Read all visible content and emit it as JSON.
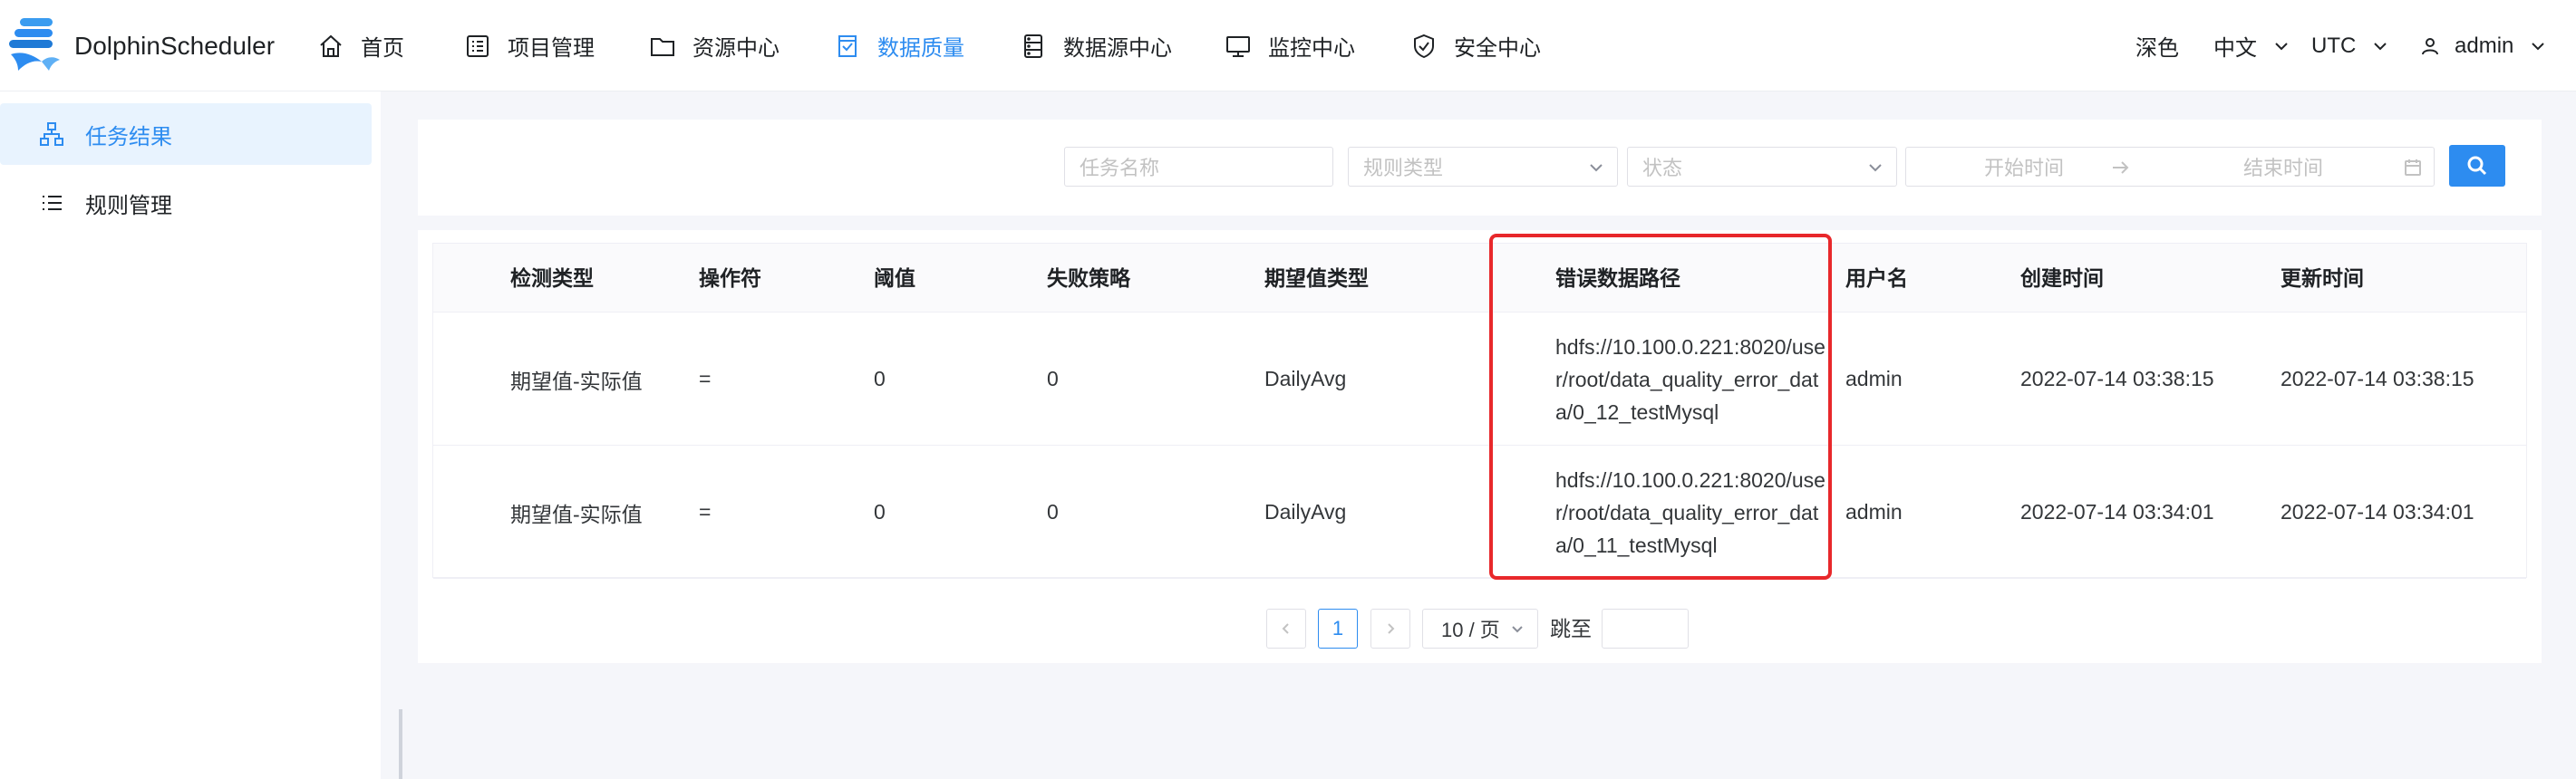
{
  "header": {
    "brand": "DolphinScheduler",
    "nav": [
      {
        "label": "首页",
        "icon": "home-icon"
      },
      {
        "label": "项目管理",
        "icon": "project-list-icon"
      },
      {
        "label": "资源中心",
        "icon": "folder-icon"
      },
      {
        "label": "数据质量",
        "icon": "data-quality-icon",
        "active": true
      },
      {
        "label": "数据源中心",
        "icon": "datasource-icon"
      },
      {
        "label": "监控中心",
        "icon": "monitor-icon"
      },
      {
        "label": "安全中心",
        "icon": "shield-icon"
      }
    ],
    "theme": "深色",
    "language": "中文",
    "timezone": "UTC",
    "user": "admin"
  },
  "sidebar": {
    "items": [
      {
        "label": "任务结果",
        "icon": "task-tree-icon",
        "active": true
      },
      {
        "label": "规则管理",
        "icon": "list-icon"
      }
    ]
  },
  "filters": {
    "task_name_placeholder": "任务名称",
    "rule_type_placeholder": "规则类型",
    "state_placeholder": "状态",
    "start_time_placeholder": "开始时间",
    "end_time_placeholder": "结束时间"
  },
  "table": {
    "columns": [
      "检测类型",
      "操作符",
      "阈值",
      "失败策略",
      "期望值类型",
      "错误数据路径",
      "用户名",
      "创建时间",
      "更新时间"
    ],
    "rows": [
      [
        "期望值-实际值",
        "=",
        "0",
        "0",
        "DailyAvg",
        "hdfs://10.100.0.221:8020/user/root/data_quality_error_data/0_12_testMysql",
        "admin",
        "2022-07-14 03:38:15",
        "2022-07-14 03:38:15"
      ],
      [
        "期望值-实际值",
        "=",
        "0",
        "0",
        "DailyAvg",
        "hdfs://10.100.0.221:8020/user/root/data_quality_error_data/0_11_testMysql",
        "admin",
        "2022-07-14 03:34:01",
        "2022-07-14 03:34:01"
      ]
    ]
  },
  "pagination": {
    "current_page": "1",
    "page_size": "10 / 页",
    "jump_label": "跳至"
  },
  "colors": {
    "accent": "#2d8cf0",
    "highlight": "#e8282b"
  }
}
